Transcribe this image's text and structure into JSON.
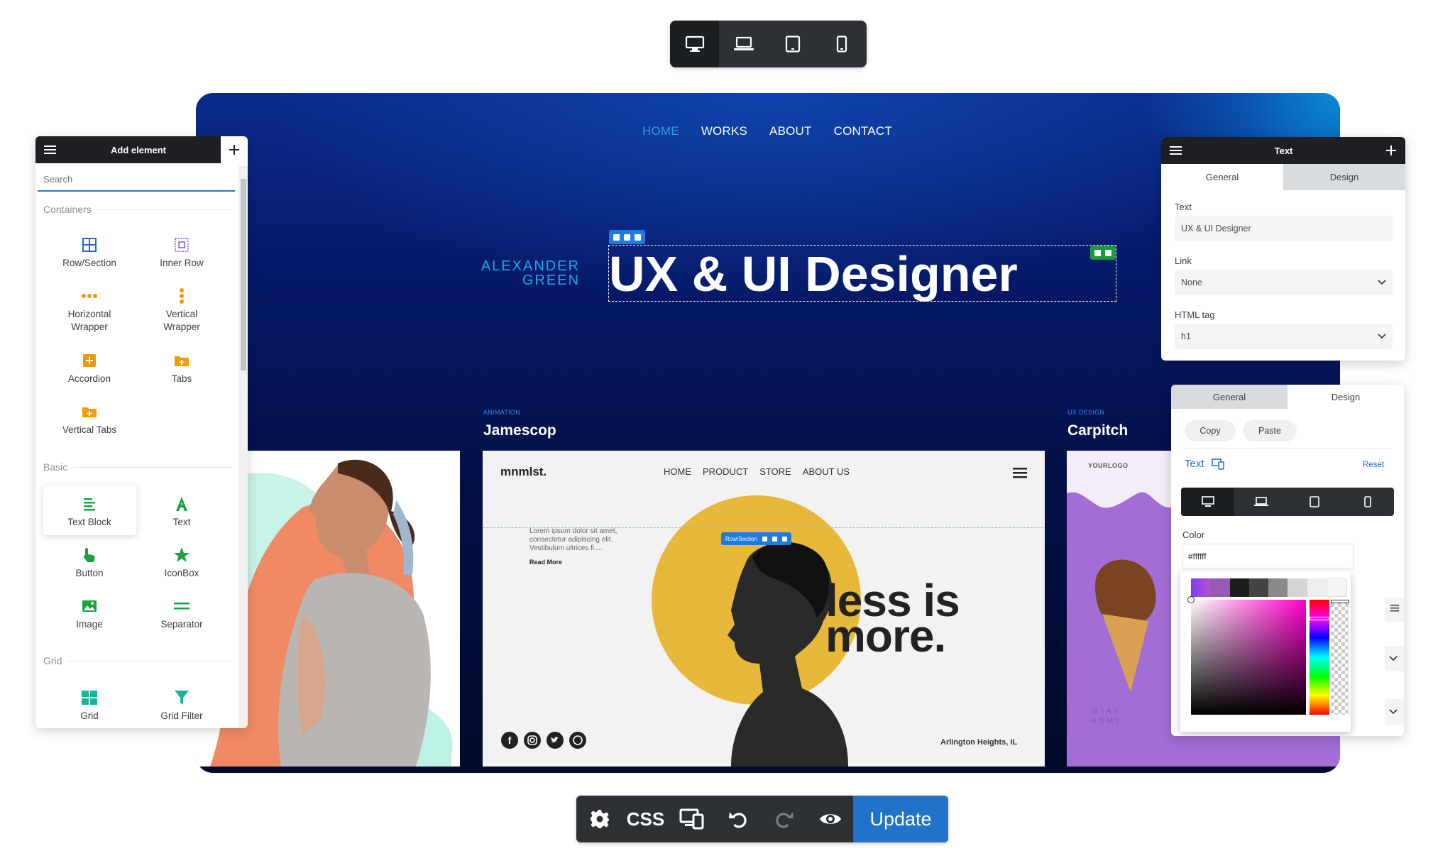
{
  "device_bar": {
    "items": [
      "desktop-icon",
      "laptop-icon",
      "tablet-icon",
      "mobile-icon"
    ],
    "active": 0
  },
  "site": {
    "nav": [
      "HOME",
      "WORKS",
      "ABOUT",
      "CONTACT"
    ],
    "author_first": "ALEXANDER",
    "author_last": "GREEN",
    "hero_title": "UX & UI Designer",
    "projects": [
      {
        "category": "ANIMATION",
        "title": "Jamescop"
      },
      {
        "category": "UX DESIGN",
        "title": "Carpitch"
      }
    ],
    "mockup": {
      "brand": "mnmlst.",
      "nav": [
        "HOME",
        "PRODUCT",
        "STORE",
        "ABOUT US"
      ],
      "lorem": "Lorem ipsum dolor sit amet, consectetur adipiscing elit. Vestibulum ultrices fi....",
      "read_more": "Read More",
      "headline_1": "less is",
      "headline_2": "more.",
      "location": "Arlington Heights, IL",
      "row_label": "Row/Section"
    },
    "carpitch": {
      "logo": "YOURLOGO",
      "stamp": "STAY HOME"
    }
  },
  "add_panel": {
    "title": "Add element",
    "search_placeholder": "Search",
    "sections": {
      "containers": {
        "label": "Containers",
        "items": [
          "Row/Section",
          "Inner Row",
          "Horizontal Wrapper",
          "Vertical Wrapper",
          "Accordion",
          "Tabs",
          "Vertical Tabs"
        ]
      },
      "basic": {
        "label": "Basic",
        "items": [
          "Text Block",
          "Text",
          "Button",
          "IconBox",
          "Image",
          "Separator"
        ]
      },
      "grid": {
        "label": "Grid",
        "items": [
          "Grid",
          "Grid Filter"
        ]
      }
    }
  },
  "text_panel": {
    "title": "Text",
    "tabs": [
      "General",
      "Design"
    ],
    "active_tab": "General",
    "fields": {
      "text_label": "Text",
      "text_value": "UX & UI Designer",
      "link_label": "Link",
      "link_value": "None",
      "html_tag_label": "HTML tag",
      "html_tag_value": "h1"
    }
  },
  "design_panel": {
    "tabs": [
      "General",
      "Design"
    ],
    "active_tab": "Design",
    "copy": "Copy",
    "paste": "Paste",
    "section_label": "Text",
    "reset": "Reset",
    "color_label": "Color",
    "color_value": "#ffffff",
    "swatches": [
      "#9b59b6",
      "#1e1e1e",
      "#444444",
      "#8a8a8a",
      "#d5d5d5",
      "#eeeeee",
      "#f5f5f5"
    ]
  },
  "bottom_bar": {
    "css": "CSS",
    "update": "Update"
  },
  "colors": {
    "accent": "#1e7be0",
    "nav_active": "#1fa3e8",
    "green": "#1b9c3a",
    "dark": "#2d3136",
    "update_blue": "#2073c8"
  }
}
